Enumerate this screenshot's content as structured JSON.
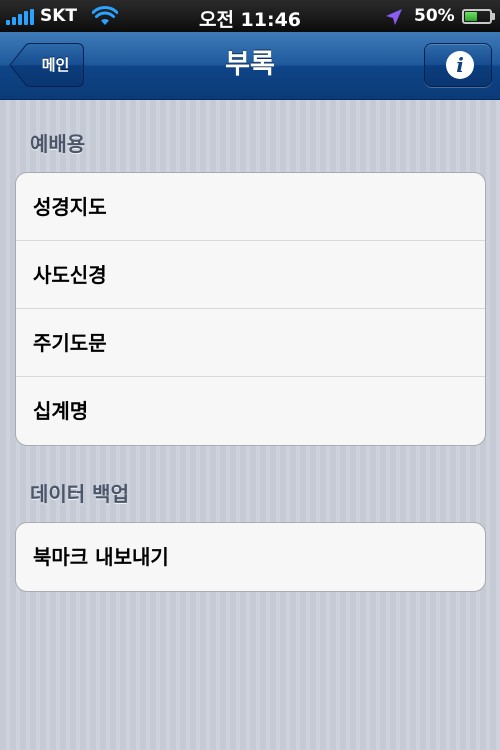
{
  "status_bar": {
    "carrier": "SKT",
    "time": "오전 11:46",
    "battery_percent": "50%",
    "battery_level": 0.5,
    "signal_icon": "signal-bars-icon",
    "wifi_icon": "wifi-icon",
    "location_icon": "location-arrow-icon",
    "battery_icon": "battery-icon"
  },
  "nav_bar": {
    "title": "부록",
    "back_label": "메인",
    "info_icon": "info-icon"
  },
  "sections": [
    {
      "header": "예배용",
      "items": [
        {
          "label": "성경지도"
        },
        {
          "label": "사도신경"
        },
        {
          "label": "주기도문"
        },
        {
          "label": "십계명"
        }
      ]
    },
    {
      "header": "데이터 백업",
      "items": [
        {
          "label": "북마크 내보내기"
        }
      ]
    }
  ],
  "colors": {
    "nav_blue": "#1f5a9e",
    "background": "#c7ccd6",
    "signal_blue": "#2aa2ff",
    "location_purple": "#8a5cf0"
  }
}
